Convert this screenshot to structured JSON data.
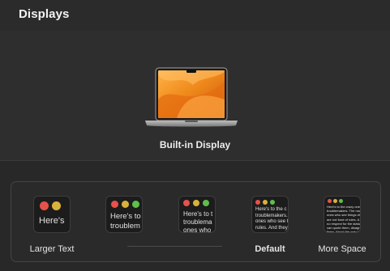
{
  "header": {
    "title": "Displays"
  },
  "display": {
    "name": "Built-in Display",
    "image_icon": "macbook-pro-icon"
  },
  "resolution": {
    "options": [
      {
        "label": "Larger Text",
        "sample": "Here's"
      },
      {
        "label": "",
        "sample": "Here's to\ntroublem"
      },
      {
        "label": "",
        "sample": "Here's to t\ntroublema\nones who"
      },
      {
        "label": "Default",
        "sample": "Here's to the c\ntroublemakers.\nones who see th\nrules. And they"
      },
      {
        "label": "More Space",
        "sample": "Here's to the crazy one\ntroublemakers. The rou\nones who see things dif\nare not fond of rules. A\nno respect for the statu\ncan quote them, disagree\nthem. About the only thi\nignore them. Because th"
      }
    ]
  },
  "colors": {
    "red": "#e5524a",
    "yellow": "#d9b23a",
    "green": "#5fbf4a"
  }
}
